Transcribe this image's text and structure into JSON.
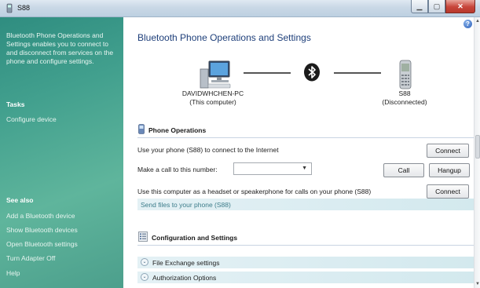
{
  "window": {
    "title": "S88",
    "minimize_glyph": "▁",
    "maximize_glyph": "▢",
    "close_glyph": "✕"
  },
  "left_pane": {
    "description": "Bluetooth Phone Operations and Settings enables you to connect to and disconnect from services on the phone and configure settings.",
    "tasks_heading": "Tasks",
    "tasks": [
      "Configure device"
    ],
    "see_also_heading": "See also",
    "see_also": [
      "Add a Bluetooth device",
      "Show Bluetooth devices",
      "Open Bluetooth settings",
      "Turn Adapter Off",
      "Help"
    ]
  },
  "main": {
    "help_glyph": "?",
    "heading": "Bluetooth Phone Operations and Settings",
    "computer": {
      "name": "DAVIDWHCHEN-PC",
      "status": "(This computer)"
    },
    "phone": {
      "name": "S88",
      "status": "(Disconnected)"
    },
    "phone_operations": {
      "heading": "Phone Operations",
      "internet_label": "Use your phone (S88) to connect to the Internet",
      "internet_button": "Connect",
      "call_label": "Make a call to this number:",
      "call_number_value": "",
      "dropdown_caret": "▼",
      "call_button": "Call",
      "hangup_button": "Hangup",
      "headset_label": "Use this computer as a headset or speakerphone for calls on your phone (S88)",
      "headset_button": "Connect",
      "send_files_label": "Send files to your phone (S88)"
    },
    "configuration": {
      "heading": "Configuration and Settings",
      "expand_glyph": "⌄",
      "items": [
        "File Exchange settings",
        "Authorization Options"
      ]
    }
  },
  "scrollbar": {
    "up_glyph": "▲",
    "down_glyph": "▼"
  },
  "colors": {
    "left_pane": "#42a08e",
    "heading": "#1e3f7a",
    "band": "#d3e9ee",
    "close_button": "#c7453a"
  }
}
